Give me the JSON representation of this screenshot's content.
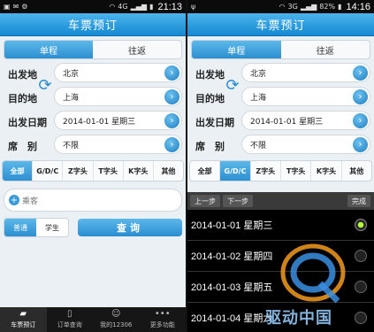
{
  "left": {
    "status": {
      "time": "21:13",
      "signal": "4G",
      "battery": ""
    },
    "title": "车票预订",
    "segments": [
      "单程",
      "往返"
    ],
    "form": {
      "from_label": "出发地",
      "from_value": "北京",
      "to_label": "目的地",
      "to_value": "上海",
      "date_label": "出发日期",
      "date_value": "2014-01-01 星期三",
      "seat_label": "席　别",
      "seat_value": "不限"
    },
    "train_tabs": [
      "全部",
      "G/D/C",
      "Z字头",
      "T字头",
      "K字头",
      "其他"
    ],
    "passenger_placeholder": "乘客",
    "ticket_types": [
      "普通",
      "学生"
    ],
    "query_label": "查询",
    "nav": [
      "车票预订",
      "订单查询",
      "我的12306",
      "更多功能"
    ]
  },
  "right": {
    "status": {
      "time": "14:16",
      "signal": "3G",
      "battery": "82%"
    },
    "title": "车票预订",
    "segments": [
      "单程",
      "往返"
    ],
    "form": {
      "from_label": "出发地",
      "from_value": "北京",
      "to_label": "目的地",
      "to_value": "上海",
      "date_label": "出发日期",
      "date_value": "2014-01-01 星期三",
      "seat_label": "席　别",
      "seat_value": "不限"
    },
    "train_tabs": [
      "全部",
      "G/D/C",
      "Z字头",
      "T字头",
      "K字头",
      "其他"
    ],
    "picker": {
      "prev": "上一步",
      "next": "下一步",
      "done": "完成",
      "options": [
        "2014-01-01 星期三",
        "2014-01-02 星期四",
        "2014-01-03 星期五",
        "2014-01-04 星期六"
      ]
    },
    "watermark": "驱动中国"
  },
  "colors": {
    "accent": "#2d8fd0",
    "title_bar": "#1789d3"
  }
}
